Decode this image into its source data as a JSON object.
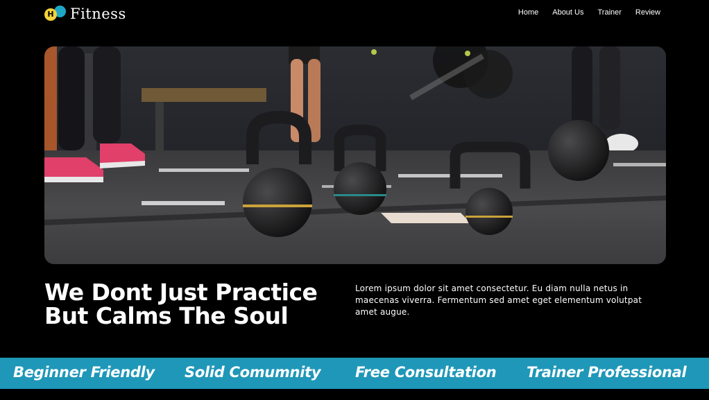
{
  "brand": {
    "logo_letter": "H",
    "name": "Fitness",
    "colors": {
      "yellow": "#f4d23a",
      "teal": "#1ea7c5"
    }
  },
  "nav": {
    "items": [
      {
        "label": "Home"
      },
      {
        "label": "About Us"
      },
      {
        "label": "Trainer"
      },
      {
        "label": "Review"
      }
    ]
  },
  "hero": {
    "image": "gym-kettlebells-photo"
  },
  "main": {
    "headline": "We Dont Just Practice But Calms The Soul",
    "description": "Lorem ipsum dolor sit amet consectetur. Eu diam nulla netus in maecenas viverra. Fermentum sed amet eget elementum volutpat amet augue."
  },
  "features": {
    "background": "#1f97b8",
    "items": [
      {
        "label": "Beginner Friendly"
      },
      {
        "label": "Solid Comumnity"
      },
      {
        "label": "Free Consultation"
      },
      {
        "label": "Trainer Professional"
      }
    ]
  }
}
